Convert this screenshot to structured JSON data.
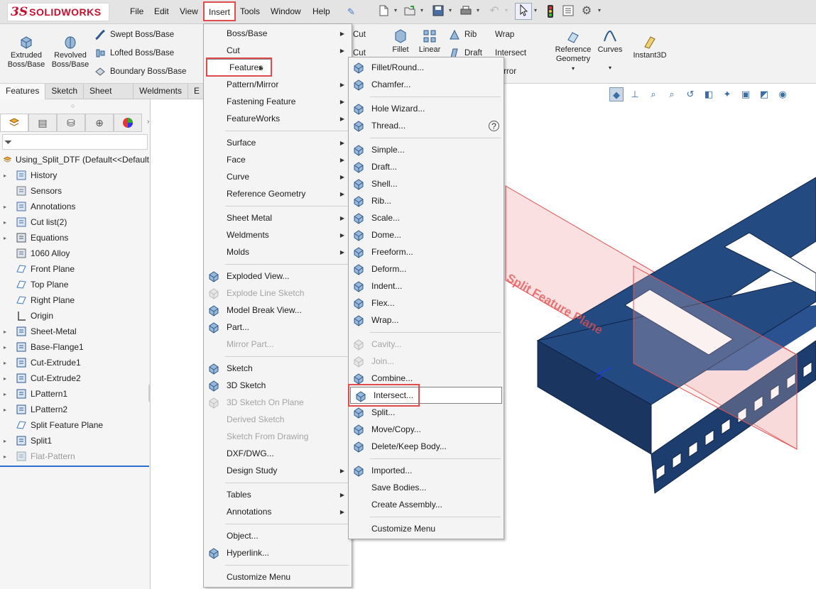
{
  "app": {
    "logo_prefix": "3S",
    "logo_text": "SOLIDWORKS"
  },
  "menubar": [
    "File",
    "Edit",
    "View",
    "Insert",
    "Tools",
    "Window",
    "Help"
  ],
  "colors": {
    "accent_red": "#e04b4b",
    "part_blue": "#244a82",
    "plane_red": "#e05050",
    "highlight_blue": "#2c6fd0"
  },
  "commands": {
    "extruded": "Extruded Boss/Base",
    "revolved": "Revolved Boss/Base",
    "swept": "Swept Boss/Base",
    "lofted": "Lofted Boss/Base",
    "boundary": "Boundary Boss/Base",
    "cut1": "Cut",
    "cut2": "Cut",
    "fillet": "Fillet",
    "linear": "Linear Patt...",
    "rib": "Rib",
    "draft": "Draft",
    "wrap": "Wrap",
    "intersect": "Intersect",
    "mirror": "Mirror",
    "refgeom": "Reference Geometry",
    "curves": "Curves",
    "instant3d": "Instant3D"
  },
  "tabs": [
    "Features",
    "Sketch",
    "Sheet Metal",
    "Weldments",
    "E"
  ],
  "tree": {
    "root": "Using_Split_DTF  (Default<<Default",
    "items": [
      {
        "label": "History",
        "expand": true,
        "icon": "history-icon"
      },
      {
        "label": "Sensors",
        "expand": false,
        "icon": "sensors-icon"
      },
      {
        "label": "Annotations",
        "expand": true,
        "icon": "annotations-icon"
      },
      {
        "label": "Cut list(2)",
        "expand": true,
        "icon": "cut-list-icon"
      },
      {
        "label": "Equations",
        "expand": true,
        "icon": "equations-icon"
      },
      {
        "label": "1060 Alloy",
        "expand": false,
        "icon": "material-icon"
      },
      {
        "label": "Front Plane",
        "expand": false,
        "icon": "plane-icon"
      },
      {
        "label": "Top Plane",
        "expand": false,
        "icon": "plane-icon"
      },
      {
        "label": "Right Plane",
        "expand": false,
        "icon": "plane-icon"
      },
      {
        "label": "Origin",
        "expand": false,
        "icon": "origin-icon"
      },
      {
        "label": "Sheet-Metal",
        "expand": true,
        "icon": "sheet-metal-icon"
      },
      {
        "label": "Base-Flange1",
        "expand": true,
        "icon": "base-flange-icon"
      },
      {
        "label": "Cut-Extrude1",
        "expand": true,
        "icon": "cut-extrude-icon"
      },
      {
        "label": "Cut-Extrude2",
        "expand": true,
        "icon": "cut-extrude-icon"
      },
      {
        "label": "LPattern1",
        "expand": true,
        "icon": "linear-pattern-icon"
      },
      {
        "label": "LPattern2",
        "expand": true,
        "icon": "linear-pattern-icon"
      },
      {
        "label": "Split Feature Plane",
        "expand": false,
        "icon": "plane-icon"
      },
      {
        "label": "Split1",
        "expand": true,
        "icon": "split-icon"
      },
      {
        "label": "Flat-Pattern",
        "expand": true,
        "icon": "flat-pattern-icon",
        "dim": true
      }
    ]
  },
  "insert_menu": [
    {
      "label": "Boss/Base",
      "arrow": true
    },
    {
      "label": "Cut",
      "arrow": true
    },
    {
      "label": "Features",
      "arrow": true,
      "hl": true
    },
    {
      "label": "Pattern/Mirror",
      "arrow": true
    },
    {
      "label": "Fastening Feature",
      "arrow": true
    },
    {
      "label": "FeatureWorks",
      "arrow": true
    },
    {
      "sep": true
    },
    {
      "label": "Surface",
      "arrow": true
    },
    {
      "label": "Face",
      "arrow": true
    },
    {
      "label": "Curve",
      "arrow": true
    },
    {
      "label": "Reference Geometry",
      "arrow": true
    },
    {
      "sep": true
    },
    {
      "label": "Sheet Metal",
      "arrow": true
    },
    {
      "label": "Weldments",
      "arrow": true
    },
    {
      "label": "Molds",
      "arrow": true
    },
    {
      "sep": true
    },
    {
      "label": "Exploded View...",
      "icon": "exploded-view-icon"
    },
    {
      "label": "Explode Line Sketch",
      "dis": true,
      "icon": "explode-line-icon"
    },
    {
      "label": "Model Break View...",
      "icon": "model-break-icon"
    },
    {
      "label": "Part...",
      "icon": "part-icon"
    },
    {
      "label": "Mirror Part...",
      "dis": true
    },
    {
      "sep": true
    },
    {
      "label": "Sketch",
      "icon": "sketch-icon"
    },
    {
      "label": "3D Sketch",
      "icon": "3d-sketch-icon"
    },
    {
      "label": "3D Sketch On Plane",
      "dis": true,
      "icon": "3d-sketch-plane-icon"
    },
    {
      "label": "Derived Sketch",
      "dis": true
    },
    {
      "label": "Sketch From Drawing",
      "dis": true
    },
    {
      "label": "DXF/DWG..."
    },
    {
      "label": "Design Study",
      "arrow": true
    },
    {
      "sep": true
    },
    {
      "label": "Tables",
      "arrow": true
    },
    {
      "label": "Annotations",
      "arrow": true
    },
    {
      "sep": true
    },
    {
      "label": "Object..."
    },
    {
      "label": "Hyperlink...",
      "icon": "hyperlink-icon"
    },
    {
      "sep": true
    },
    {
      "label": "Customize Menu"
    }
  ],
  "features_menu": [
    {
      "label": "Fillet/Round...",
      "icon": "fillet-icon"
    },
    {
      "label": "Chamfer...",
      "icon": "chamfer-icon"
    },
    {
      "sep": true
    },
    {
      "label": "Hole Wizard...",
      "icon": "hole-wizard-icon"
    },
    {
      "label": "Thread...",
      "icon": "thread-icon",
      "help": true
    },
    {
      "sep": true
    },
    {
      "label": "Simple...",
      "icon": "simple-hole-icon"
    },
    {
      "label": "Draft...",
      "icon": "draft-icon"
    },
    {
      "label": "Shell...",
      "icon": "shell-icon"
    },
    {
      "label": "Rib...",
      "icon": "rib-icon"
    },
    {
      "label": "Scale...",
      "icon": "scale-icon"
    },
    {
      "label": "Dome...",
      "icon": "dome-icon"
    },
    {
      "label": "Freeform...",
      "icon": "freeform-icon"
    },
    {
      "label": "Deform...",
      "icon": "deform-icon"
    },
    {
      "label": "Indent...",
      "icon": "indent-icon"
    },
    {
      "label": "Flex...",
      "icon": "flex-icon"
    },
    {
      "label": "Wrap...",
      "icon": "wrap-icon"
    },
    {
      "sep": true
    },
    {
      "label": "Cavity...",
      "dis": true,
      "icon": "cavity-icon"
    },
    {
      "label": "Join...",
      "dis": true,
      "icon": "join-icon"
    },
    {
      "label": "Combine...",
      "icon": "combine-icon"
    },
    {
      "label": "Intersect...",
      "icon": "intersect-icon",
      "hl": true
    },
    {
      "label": "Split...",
      "icon": "split-icon"
    },
    {
      "label": "Move/Copy...",
      "icon": "move-copy-icon"
    },
    {
      "label": "Delete/Keep Body...",
      "icon": "delete-body-icon"
    },
    {
      "sep": true
    },
    {
      "label": "Imported...",
      "icon": "imported-icon"
    },
    {
      "label": "Save Bodies..."
    },
    {
      "label": "Create Assembly..."
    },
    {
      "sep": true
    },
    {
      "label": "Customize Menu"
    }
  ],
  "viewport": {
    "plane_label": "Split Feature Plane"
  }
}
